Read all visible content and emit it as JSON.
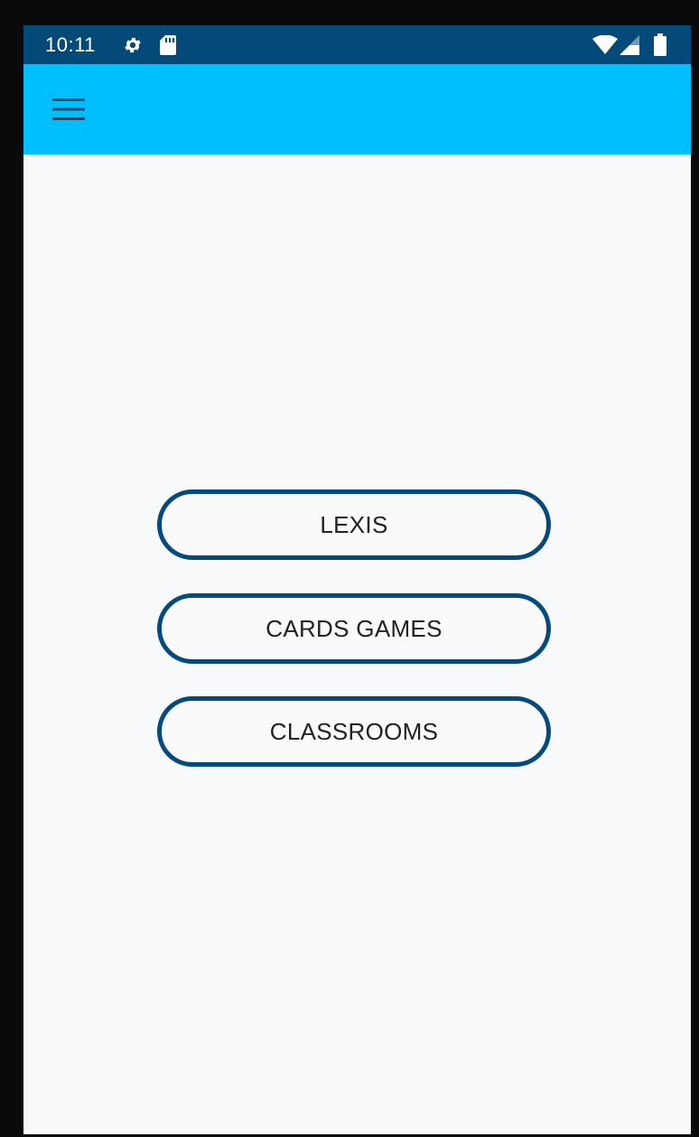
{
  "status_bar": {
    "time": "10:11",
    "icons": [
      "settings-gear-icon",
      "sd-card-icon",
      "wifi-icon",
      "cellular-signal-icon",
      "battery-icon"
    ],
    "background_color": "#034a78"
  },
  "app_bar": {
    "menu_icon": "hamburger-menu-icon",
    "background_color": "#00bfff"
  },
  "main": {
    "buttons": [
      {
        "label": "LEXIS"
      },
      {
        "label": "CARDS GAMES"
      },
      {
        "label": "CLASSROOMS"
      }
    ],
    "button_border_color": "#044a7c"
  }
}
